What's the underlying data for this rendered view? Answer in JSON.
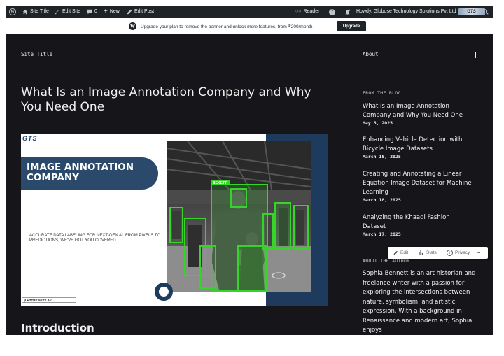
{
  "admin_bar": {
    "site_title": "Site Title",
    "edit_site": "Edit Site",
    "comments_count": "0",
    "new_label": "New",
    "edit_post": "Edit Post",
    "reader": "Reader",
    "howdy": "Howdy, Globose Technology Solutions Pvt Ltd",
    "avatar_text": "GTS"
  },
  "banner": {
    "message": "Upgrade your plan to remove the banner and unlock more features, from ₹200/month",
    "button": "Upgrade"
  },
  "header": {
    "site_title": "Site Title",
    "about": "About"
  },
  "post": {
    "title": "What Is an Image Annotation Company and Why You Need One",
    "featured": {
      "logo": "GTS",
      "heading": "IMAGE ANNOTATION COMPANY",
      "tagline": "ACCURATE DATA LABELING FOR NEXT-GEN AI. FROM PIXELS TO PREDICTIONS, WE'VE GOT YOU COVERED.",
      "url": "HTTPS://GTS.AI/",
      "photo_label": "BEKETT"
    },
    "section_heading": "Introduction"
  },
  "sidebar": {
    "from_blog": "FROM THE BLOG",
    "posts": [
      {
        "title": "What Is an Image Annotation Company and Why You Need One",
        "date": "May 6, 2025"
      },
      {
        "title": "Enhancing Vehicle Detection with Bicycle Image Datasets",
        "date": "March 18, 2025"
      },
      {
        "title": "Creating and Annotating a Linear Equation Image Dataset for Machine Learning",
        "date": "March 18, 2025"
      },
      {
        "title": "Analyzing the Khaadi Fashion Dataset",
        "date": "March 17, 2025"
      }
    ],
    "about_author": "ABOUT THE AUTHOR",
    "bio": "Sophia Bennett is an art historian and freelance writer with a passion for exploring the intersections between nature, symbolism, and artistic expression. With a background in Renaissance and modern art, Sophia enjoys"
  },
  "toolbar": {
    "edit": "Edit",
    "stats": "Stats",
    "privacy": "Privacy",
    "more": "•••"
  },
  "colors": {
    "admin_bar": "#1d2327",
    "page_bg": "#16161a",
    "navy": "#1e3a5c",
    "annotation_green": "#39d42a"
  }
}
